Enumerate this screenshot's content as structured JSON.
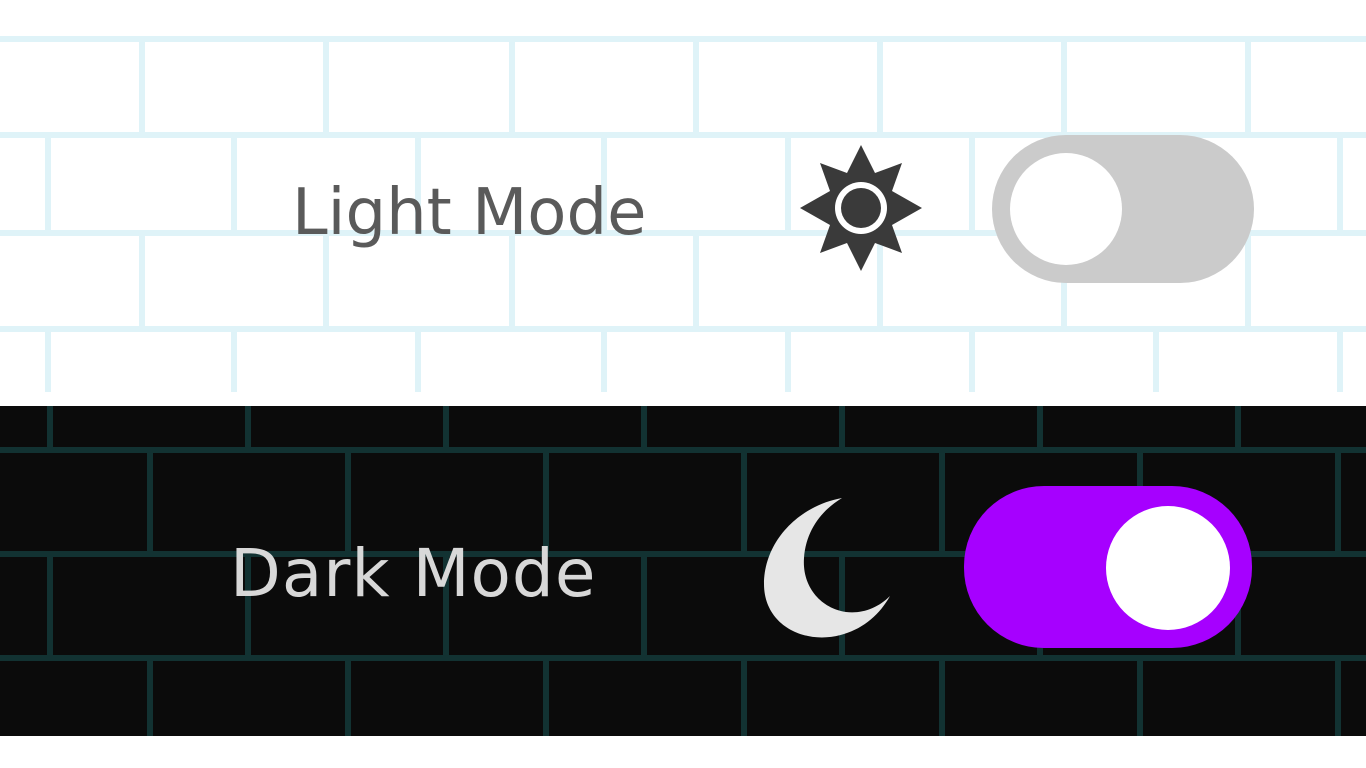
{
  "light_mode": {
    "label": "Light Mode",
    "icon": "sun-icon",
    "toggle_on": false,
    "colors": {
      "background": "#ffffff",
      "grid_lines": "#dff3f8",
      "text": "#5a5a5a",
      "icon": "#3a3a3a",
      "track": "#cbcbcb",
      "knob": "#ffffff"
    }
  },
  "dark_mode": {
    "label": "Dark Mode",
    "icon": "moon-icon",
    "toggle_on": true,
    "colors": {
      "background": "#0b0b0b",
      "grid_lines": "#123232",
      "text": "#d8d8d8",
      "icon": "#e6e6e6",
      "track": "#a600ff",
      "knob": "#ffffff"
    }
  }
}
